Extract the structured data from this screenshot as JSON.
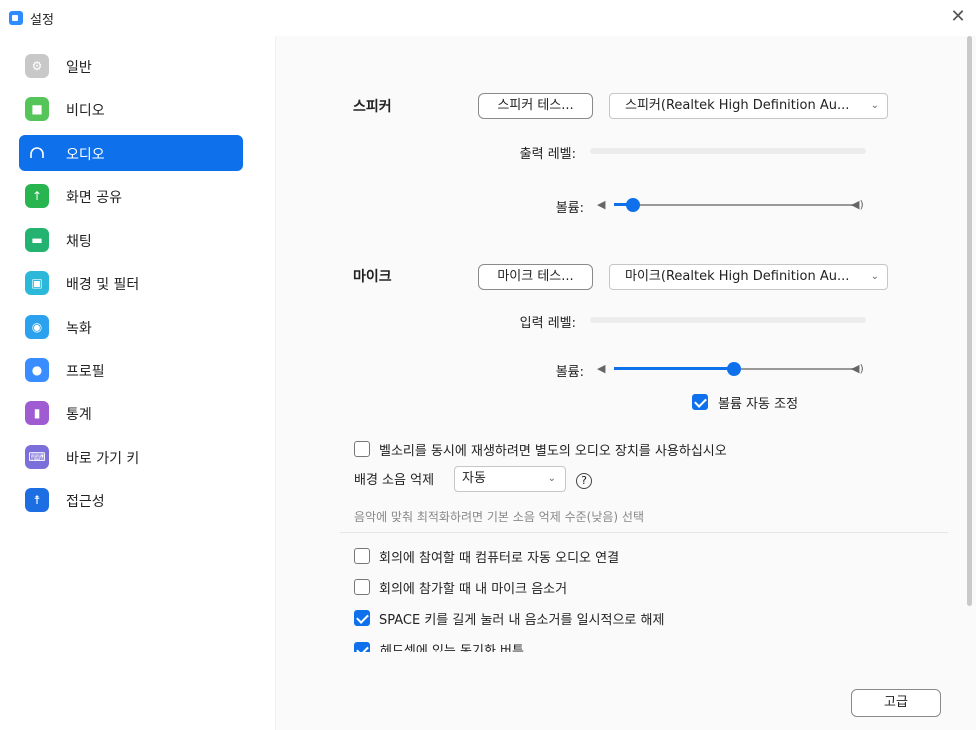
{
  "window": {
    "title": "설정",
    "close_icon": "✕"
  },
  "sidebar": {
    "items": [
      {
        "label": "일반",
        "icon": "gear-icon",
        "color": "#c8c8c8"
      },
      {
        "label": "비디오",
        "icon": "video-camera-icon",
        "color": "#55c55a"
      },
      {
        "label": "오디오",
        "icon": "headphones-icon",
        "color": "#0e71eb",
        "active": true
      },
      {
        "label": "화면 공유",
        "icon": "share-screen-icon",
        "color": "#28b550"
      },
      {
        "label": "채팅",
        "icon": "chat-bubble-icon",
        "color": "#23b26f"
      },
      {
        "label": "배경 및 필터",
        "icon": "background-icon",
        "color": "#2cb8d8"
      },
      {
        "label": "녹화",
        "icon": "record-icon",
        "color": "#2ca2ee"
      },
      {
        "label": "프로필",
        "icon": "profile-icon",
        "color": "#3a8dff"
      },
      {
        "label": "통계",
        "icon": "statistics-icon",
        "color": "#9f5bd1"
      },
      {
        "label": "바로 가기 키",
        "icon": "keyboard-icon",
        "color": "#7b6fd9"
      },
      {
        "label": "접근성",
        "icon": "accessibility-icon",
        "color": "#1d6ee3"
      }
    ]
  },
  "speaker": {
    "label": "스피커",
    "test_button": "스피커 테스...",
    "device": "스피커(Realtek High Definition Au...",
    "output_level_label": "출력 레벨:",
    "volume_label": "볼륨:",
    "volume_percent": 8
  },
  "microphone": {
    "label": "마이크",
    "test_button": "마이크 테스...",
    "device": "마이크(Realtek High Definition Au...",
    "input_level_label": "입력 레벨:",
    "volume_label": "볼륨:",
    "volume_percent": 50,
    "auto_adjust": {
      "label": "볼륨 자동 조정",
      "checked": true
    }
  },
  "options": {
    "separate_device": {
      "label": "벨소리를 동시에 재생하려면 별도의 오디오 장치를 사용하십시오",
      "checked": false
    },
    "noise_suppression": {
      "label": "배경 소음 억제",
      "value": "자동",
      "help": "?"
    },
    "noise_hint": "음악에 맞춰 최적화하려면 기본 소음 억제 수준(낮음) 선택",
    "auto_join": {
      "label": "회의에 참여할 때 컴퓨터로 자동 오디오 연결",
      "checked": false
    },
    "mute_on_join": {
      "label": "회의에 참가할 때 내 마이크 음소거",
      "checked": false
    },
    "space_unmute": {
      "label": "SPACE 키를 길게 눌러 내 음소거를 일시적으로 해제",
      "checked": true
    },
    "headset_sync": {
      "label": "헤드셋에 있는 동기화 버튼",
      "checked": true
    }
  },
  "advanced_button": "고급",
  "colors": {
    "accent": "#0e71eb"
  }
}
